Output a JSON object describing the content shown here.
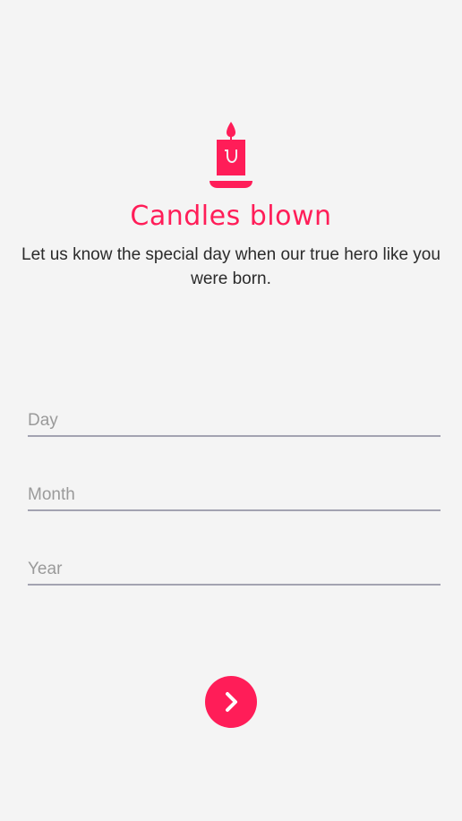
{
  "header": {
    "icon": "candle-icon",
    "title": "Candles blown",
    "subtitle": "Let us know the special day when our true hero like you were born."
  },
  "form": {
    "day_placeholder": "Day",
    "month_placeholder": "Month",
    "year_placeholder": "Year"
  },
  "actions": {
    "next_icon": "chevron-right-icon"
  },
  "colors": {
    "accent": "#ff1d58",
    "background": "#f4f4f4",
    "underline": "#a3a3b1",
    "text": "#2b2b2b",
    "placeholder": "#9a9a9a"
  }
}
